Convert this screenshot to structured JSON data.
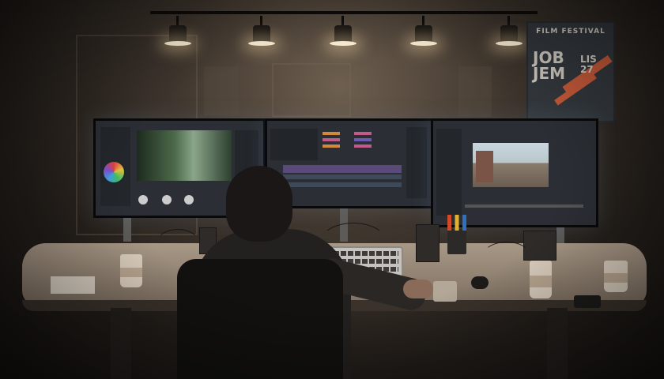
{
  "scene": {
    "poster": {
      "title": "FILM FESTIVAL",
      "big_text": "JOB JEM",
      "side_text": "LIS 27"
    },
    "monitors": [
      {
        "name": "left",
        "content": "color-grading-panel"
      },
      {
        "name": "center",
        "content": "timeline"
      },
      {
        "name": "right",
        "content": "preview-player"
      }
    ],
    "colors": {
      "lamp_glow": "#fff3d8",
      "poster_accent": "#c65a3a",
      "timeline_clip_orange": "#d08a3a",
      "timeline_clip_pink": "#c25a8a",
      "timeline_clip_purple": "#6a5ab0"
    }
  }
}
